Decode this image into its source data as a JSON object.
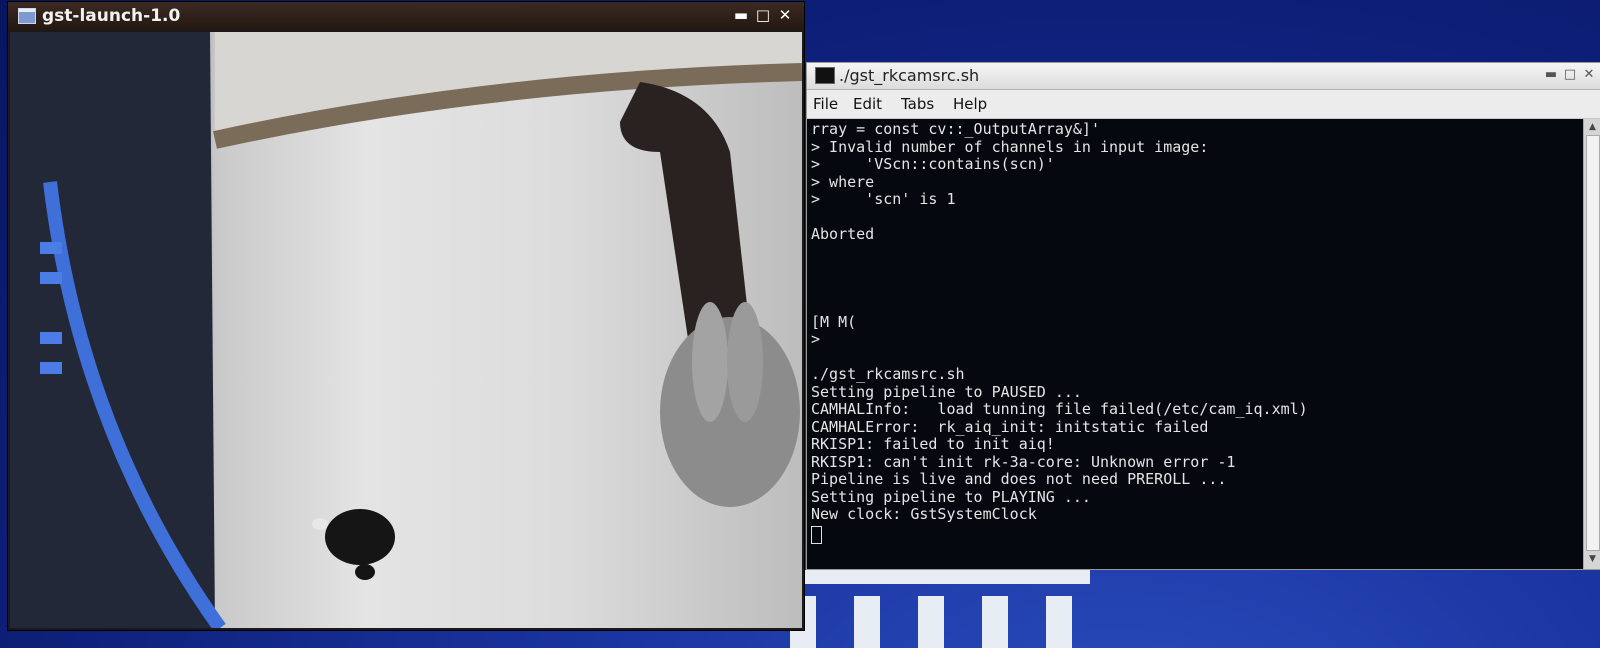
{
  "gst_window": {
    "title": "gst-launch-1.0",
    "controls": {
      "minimize": "▬",
      "maximize": "□",
      "close": "✕"
    }
  },
  "terminal_window": {
    "title": "./gst_rkcamsrc.sh",
    "controls": {
      "minimize": "▬",
      "maximize": "□",
      "close": "✕"
    },
    "menu": {
      "file": "File",
      "edit": "Edit",
      "tabs": "Tabs",
      "help": "Help"
    },
    "lines": [
      "rray = const cv::_OutputArray&]'",
      "> Invalid number of channels in input image:",
      ">     'VScn::contains(scn)'",
      "> where",
      ">     'scn' is 1",
      "",
      "Aborted",
      "",
      "",
      "",
      "",
      "[M M(",
      ">",
      "",
      "./gst_rkcamsrc.sh",
      "Setting pipeline to PAUSED ...",
      "CAMHALInfo:   load tunning file failed(/etc/cam_iq.xml)",
      "CAMHALError:  rk_aiq_init: initstatic failed",
      "RKISP1: failed to init aiq!",
      "RKISP1: can't init rk-3a-core: Unknown error -1",
      "Pipeline is live and does not need PREROLL ...",
      "Setting pipeline to PLAYING ...",
      "New clock: GstSystemClock"
    ]
  }
}
